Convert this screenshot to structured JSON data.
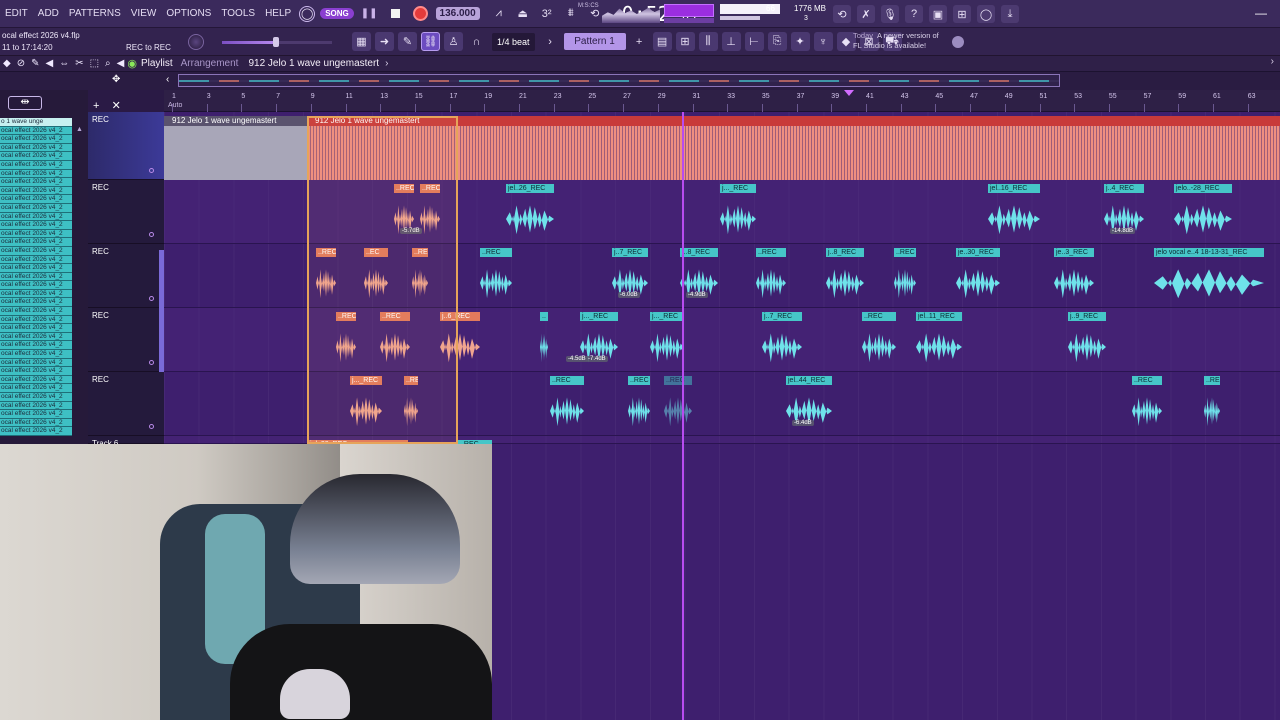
{
  "menu": [
    "EDIT",
    "ADD",
    "PATTERNS",
    "VIEW",
    "OPTIONS",
    "TOOLS",
    "HELP"
  ],
  "transport": {
    "mode": "SONG",
    "tempo": "136.000",
    "time_main": "0:52",
    "time_sub": "85",
    "time_unit": "M:S:CS"
  },
  "stats": {
    "cpu": "66",
    "memory": "1776 MB",
    "voices": "3"
  },
  "project": {
    "name": "ocal effect 2026 v4.flp",
    "time": "11 to 17:14:20",
    "rec_to": "REC to REC"
  },
  "toolbar": {
    "snap": "1/4 beat",
    "pattern": "Pattern 1"
  },
  "news": {
    "today": "Today",
    "line1": "A newer version of",
    "line2": "FL Studio is available!"
  },
  "playlist": {
    "title": "Playlist",
    "sub": "Arrangement",
    "clip": "912 Jelo 1 wave ungemastert"
  },
  "ruler": {
    "auto": "Auto",
    "numbers": [
      "1",
      "3",
      "5",
      "7",
      "9",
      "11",
      "13",
      "15",
      "17",
      "19",
      "21",
      "23",
      "25",
      "27",
      "29",
      "31",
      "33",
      "35",
      "37",
      "39",
      "41",
      "43",
      "45",
      "47",
      "49",
      "51",
      "53",
      "55",
      "57",
      "59",
      "61",
      "63"
    ]
  },
  "left_clips": [
    "o 1 wave unge",
    "ocal effect 2026 v4_2",
    "ocal effect 2026 v4_2",
    "ocal effect 2026 v4_2",
    "ocal effect 2026 v4_2",
    "ocal effect 2026 v4_2",
    "ocal effect 2026 v4_2",
    "ocal effect 2026 v4_2",
    "ocal effect 2026 v4_2",
    "ocal effect 2026 v4_2",
    "ocal effect 2026 v4_2",
    "ocal effect 2026 v4_2",
    "ocal effect 2026 v4_2",
    "ocal effect 2026 v4_2",
    "ocal effect 2026 v4_2",
    "ocal effect 2026 v4_2",
    "ocal effect 2026 v4_2",
    "ocal effect 2026 v4_2",
    "ocal effect 2026 v4_2",
    "ocal effect 2026 v4_2",
    "ocal effect 2026 v4_2",
    "ocal effect 2026 v4_2",
    "ocal effect 2026 v4_2",
    "ocal effect 2026 v4_2",
    "ocal effect 2026 v4_2",
    "ocal effect 2026 v4_2",
    "ocal effect 2026 v4_2",
    "ocal effect 2026 v4_2",
    "ocal effect 2026 v4_2",
    "ocal effect 2026 v4_2",
    "ocal effect 2026 v4_2",
    "ocal effect 2026 v4_2",
    "ocal effect 2026 v4_2",
    "ocal effect 2026 v4_2",
    "ocal effect 2026 v4_2",
    "ocal effect 2026 v4_2",
    "ocal effect 2026 v4_2"
  ],
  "tracks": [
    {
      "name": "REC"
    },
    {
      "name": "REC"
    },
    {
      "name": "REC"
    },
    {
      "name": "REC"
    },
    {
      "name": "REC"
    },
    {
      "name": "Track 6"
    }
  ],
  "big_clip": {
    "label_left": "912 Jelo 1 wave ungemastert",
    "label_main": "912 Jelo 1 wave ungemastert"
  },
  "clips": {
    "t2": [
      "..REC",
      "..REC",
      "jel..26_REC",
      "j..._REC",
      "jel..16_REC",
      "j..4_REC",
      "jelo..-28_REC"
    ],
    "t2_gain": [
      "-5.7dB",
      "-14.8dB"
    ],
    "t3": [
      "..REC",
      "..EC",
      "..REC",
      "..REC",
      "j..7_REC",
      "j..8_REC",
      "..REC",
      "j..8_REC",
      "..REC",
      "je..30_REC",
      "je..3_REC",
      "jelo vocal e..4 18-13-31_REC"
    ],
    "t3_gain": [
      "-6.0dB",
      "-4.9dB"
    ],
    "t4": [
      "..REC",
      "..REC",
      "j..6_REC",
      "..",
      "j..._REC",
      "j..._REC",
      "j..7_REC",
      "..REC",
      "jel..11_REC",
      "j..9_REC"
    ],
    "t4_gain": [
      "-4.5dB",
      "-7.4dB"
    ],
    "t5": [
      "j..._REC",
      "..REC",
      "..REC",
      "..REC",
      "..REC",
      "jel..44_REC",
      "..REC",
      "..REC"
    ],
    "t5_gain": [
      "-6.4dB"
    ],
    "t6": [
      "jel..22_REC",
      "..REC"
    ]
  }
}
